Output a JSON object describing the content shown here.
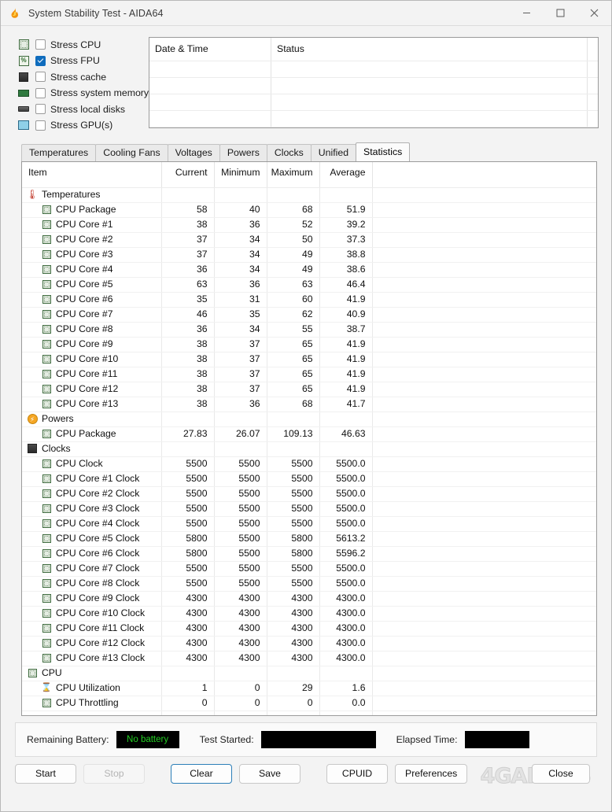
{
  "window": {
    "title": "System Stability Test - AIDA64",
    "icon": "flame-icon",
    "minimize": "—",
    "maximize": "□",
    "close": "✕"
  },
  "stress_options": [
    {
      "label": "Stress CPU",
      "checked": false,
      "icon": "cpu-chip-icon"
    },
    {
      "label": "Stress FPU",
      "checked": true,
      "icon": "fpu-percent-icon"
    },
    {
      "label": "Stress cache",
      "checked": false,
      "icon": "cache-icon"
    },
    {
      "label": "Stress system memory",
      "checked": false,
      "icon": "memory-module-icon"
    },
    {
      "label": "Stress local disks",
      "checked": false,
      "icon": "hard-disk-icon"
    },
    {
      "label": "Stress GPU(s)",
      "checked": false,
      "icon": "gpu-card-icon"
    }
  ],
  "log": {
    "columns": [
      "Date & Time",
      "Status"
    ],
    "rows": []
  },
  "tabs": [
    {
      "label": "Temperatures",
      "active": false
    },
    {
      "label": "Cooling Fans",
      "active": false
    },
    {
      "label": "Voltages",
      "active": false
    },
    {
      "label": "Powers",
      "active": false
    },
    {
      "label": "Clocks",
      "active": false
    },
    {
      "label": "Unified",
      "active": false
    },
    {
      "label": "Statistics",
      "active": true
    }
  ],
  "statistics": {
    "columns": [
      "Item",
      "Current",
      "Minimum",
      "Maximum",
      "Average"
    ],
    "rows": [
      {
        "type": "group",
        "icon": "thermometer-icon",
        "item": "Temperatures",
        "current": "",
        "minimum": "",
        "maximum": "",
        "average": ""
      },
      {
        "type": "leaf",
        "icon": "chip-icon",
        "item": "CPU Package",
        "current": "58",
        "minimum": "40",
        "maximum": "68",
        "average": "51.9"
      },
      {
        "type": "leaf",
        "icon": "chip-icon",
        "item": "CPU Core #1",
        "current": "38",
        "minimum": "36",
        "maximum": "52",
        "average": "39.2"
      },
      {
        "type": "leaf",
        "icon": "chip-icon",
        "item": "CPU Core #2",
        "current": "37",
        "minimum": "34",
        "maximum": "50",
        "average": "37.3"
      },
      {
        "type": "leaf",
        "icon": "chip-icon",
        "item": "CPU Core #3",
        "current": "37",
        "minimum": "34",
        "maximum": "49",
        "average": "38.8"
      },
      {
        "type": "leaf",
        "icon": "chip-icon",
        "item": "CPU Core #4",
        "current": "36",
        "minimum": "34",
        "maximum": "49",
        "average": "38.6"
      },
      {
        "type": "leaf",
        "icon": "chip-icon",
        "item": "CPU Core #5",
        "current": "63",
        "minimum": "36",
        "maximum": "63",
        "average": "46.4"
      },
      {
        "type": "leaf",
        "icon": "chip-icon",
        "item": "CPU Core #6",
        "current": "35",
        "minimum": "31",
        "maximum": "60",
        "average": "41.9"
      },
      {
        "type": "leaf",
        "icon": "chip-icon",
        "item": "CPU Core #7",
        "current": "46",
        "minimum": "35",
        "maximum": "62",
        "average": "40.9"
      },
      {
        "type": "leaf",
        "icon": "chip-icon",
        "item": "CPU Core #8",
        "current": "36",
        "minimum": "34",
        "maximum": "55",
        "average": "38.7"
      },
      {
        "type": "leaf",
        "icon": "chip-icon",
        "item": "CPU Core #9",
        "current": "38",
        "minimum": "37",
        "maximum": "65",
        "average": "41.9"
      },
      {
        "type": "leaf",
        "icon": "chip-icon",
        "item": "CPU Core #10",
        "current": "38",
        "minimum": "37",
        "maximum": "65",
        "average": "41.9"
      },
      {
        "type": "leaf",
        "icon": "chip-icon",
        "item": "CPU Core #11",
        "current": "38",
        "minimum": "37",
        "maximum": "65",
        "average": "41.9"
      },
      {
        "type": "leaf",
        "icon": "chip-icon",
        "item": "CPU Core #12",
        "current": "38",
        "minimum": "37",
        "maximum": "65",
        "average": "41.9"
      },
      {
        "type": "leaf",
        "icon": "chip-icon",
        "item": "CPU Core #13",
        "current": "38",
        "minimum": "36",
        "maximum": "68",
        "average": "41.7"
      },
      {
        "type": "group",
        "icon": "power-bolt-icon",
        "item": "Powers",
        "current": "",
        "minimum": "",
        "maximum": "",
        "average": ""
      },
      {
        "type": "leaf",
        "icon": "chip-icon",
        "item": "CPU Package",
        "current": "27.83",
        "minimum": "26.07",
        "maximum": "109.13",
        "average": "46.63"
      },
      {
        "type": "group",
        "icon": "clock-module-icon",
        "item": "Clocks",
        "current": "",
        "minimum": "",
        "maximum": "",
        "average": ""
      },
      {
        "type": "leaf",
        "icon": "chip-icon",
        "item": "CPU Clock",
        "current": "5500",
        "minimum": "5500",
        "maximum": "5500",
        "average": "5500.0"
      },
      {
        "type": "leaf",
        "icon": "chip-icon",
        "item": "CPU Core #1 Clock",
        "current": "5500",
        "minimum": "5500",
        "maximum": "5500",
        "average": "5500.0"
      },
      {
        "type": "leaf",
        "icon": "chip-icon",
        "item": "CPU Core #2 Clock",
        "current": "5500",
        "minimum": "5500",
        "maximum": "5500",
        "average": "5500.0"
      },
      {
        "type": "leaf",
        "icon": "chip-icon",
        "item": "CPU Core #3 Clock",
        "current": "5500",
        "minimum": "5500",
        "maximum": "5500",
        "average": "5500.0"
      },
      {
        "type": "leaf",
        "icon": "chip-icon",
        "item": "CPU Core #4 Clock",
        "current": "5500",
        "minimum": "5500",
        "maximum": "5500",
        "average": "5500.0"
      },
      {
        "type": "leaf",
        "icon": "chip-icon",
        "item": "CPU Core #5 Clock",
        "current": "5800",
        "minimum": "5500",
        "maximum": "5800",
        "average": "5613.2"
      },
      {
        "type": "leaf",
        "icon": "chip-icon",
        "item": "CPU Core #6 Clock",
        "current": "5800",
        "minimum": "5500",
        "maximum": "5800",
        "average": "5596.2"
      },
      {
        "type": "leaf",
        "icon": "chip-icon",
        "item": "CPU Core #7 Clock",
        "current": "5500",
        "minimum": "5500",
        "maximum": "5500",
        "average": "5500.0"
      },
      {
        "type": "leaf",
        "icon": "chip-icon",
        "item": "CPU Core #8 Clock",
        "current": "5500",
        "minimum": "5500",
        "maximum": "5500",
        "average": "5500.0"
      },
      {
        "type": "leaf",
        "icon": "chip-icon",
        "item": "CPU Core #9 Clock",
        "current": "4300",
        "minimum": "4300",
        "maximum": "4300",
        "average": "4300.0"
      },
      {
        "type": "leaf",
        "icon": "chip-icon",
        "item": "CPU Core #10 Clock",
        "current": "4300",
        "minimum": "4300",
        "maximum": "4300",
        "average": "4300.0"
      },
      {
        "type": "leaf",
        "icon": "chip-icon",
        "item": "CPU Core #11 Clock",
        "current": "4300",
        "minimum": "4300",
        "maximum": "4300",
        "average": "4300.0"
      },
      {
        "type": "leaf",
        "icon": "chip-icon",
        "item": "CPU Core #12 Clock",
        "current": "4300",
        "minimum": "4300",
        "maximum": "4300",
        "average": "4300.0"
      },
      {
        "type": "leaf",
        "icon": "chip-icon",
        "item": "CPU Core #13 Clock",
        "current": "4300",
        "minimum": "4300",
        "maximum": "4300",
        "average": "4300.0"
      },
      {
        "type": "group",
        "icon": "chip-icon",
        "item": "CPU",
        "current": "",
        "minimum": "",
        "maximum": "",
        "average": ""
      },
      {
        "type": "leaf",
        "icon": "hourglass-icon",
        "item": "CPU Utilization",
        "current": "1",
        "minimum": "0",
        "maximum": "29",
        "average": "1.6"
      },
      {
        "type": "leaf",
        "icon": "chip-icon",
        "item": "CPU Throttling",
        "current": "0",
        "minimum": "0",
        "maximum": "0",
        "average": "0.0"
      }
    ]
  },
  "status": {
    "battery_label": "Remaining Battery:",
    "battery_value": "No battery",
    "battery_color": "#22cc22",
    "started_label": "Test Started:",
    "started_value": "",
    "elapsed_label": "Elapsed Time:",
    "elapsed_value": ""
  },
  "buttons": {
    "start": "Start",
    "stop": "Stop",
    "clear": "Clear",
    "save": "Save",
    "cpuid": "CPUID",
    "preferences": "Preferences",
    "close": "Close"
  },
  "watermark": "4GAMERS"
}
